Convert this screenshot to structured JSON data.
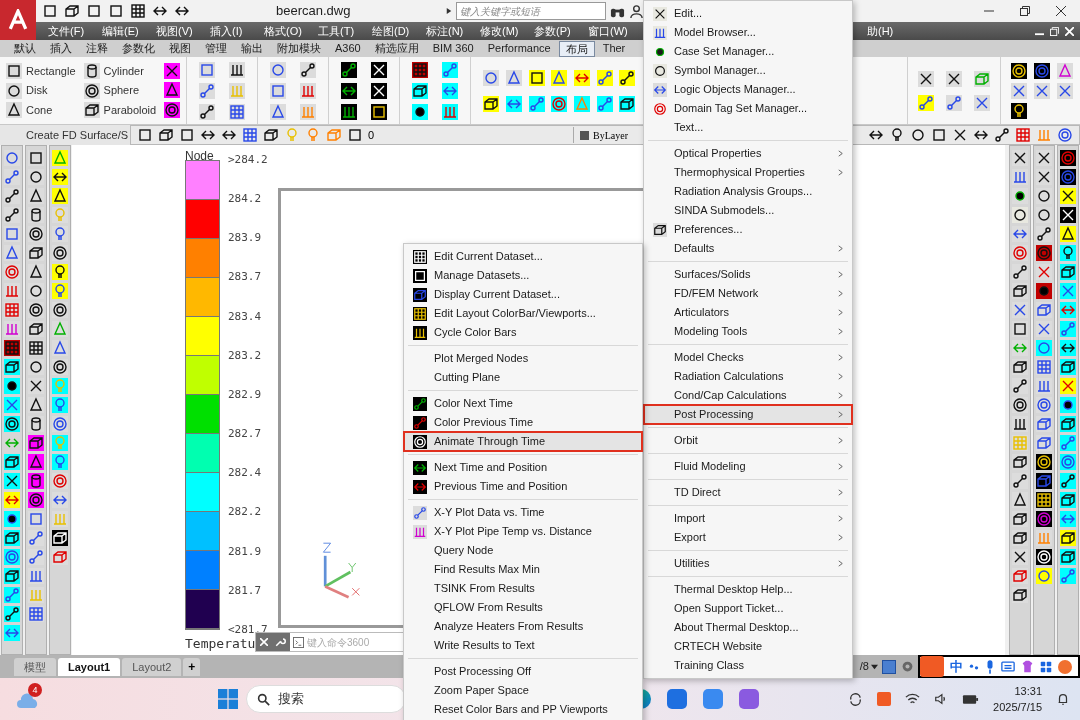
{
  "title_bar": {
    "title": "beercan.dwg",
    "search": {
      "placeholder": "键入关键字或短语"
    }
  },
  "menu_bar": {
    "items": [
      "文件(F)",
      "编辑(E)",
      "视图(V)",
      "插入(I)",
      "格式(O)",
      "工具(T)",
      "绘图(D)",
      "标注(N)",
      "修改(M)",
      "参数(P)",
      "窗口(W)"
    ],
    "help_fragment": "助(H)"
  },
  "ribbon_tabs": [
    {
      "label": "默认",
      "selected": false
    },
    {
      "label": "插入",
      "selected": false
    },
    {
      "label": "注释",
      "selected": false
    },
    {
      "label": "参数化",
      "selected": false
    },
    {
      "label": "视图",
      "selected": false
    },
    {
      "label": "管理",
      "selected": false
    },
    {
      "label": "输出",
      "selected": false
    },
    {
      "label": "附加模块",
      "selected": false
    },
    {
      "label": "A360",
      "selected": false
    },
    {
      "label": "精选应用",
      "selected": false
    },
    {
      "label": "BIM 360",
      "selected": false
    },
    {
      "label": "Performance",
      "selected": false
    },
    {
      "label": "布局",
      "selected": true
    },
    {
      "label": "Ther",
      "selected": false
    }
  ],
  "ribbon_panel": {
    "tools": [
      "Rectangle",
      "Cylinder",
      "Disk",
      "Sphere",
      "Cone",
      "Paraboloid"
    ],
    "panel_label": "Create FD Surface/S"
  },
  "toolbar": {
    "layer": "0",
    "linetype": "ByLayer"
  },
  "color_bar": {
    "title": "Node",
    "quantity": "Temperatu",
    "swatches": [
      {
        "color": "#ff80ff"
      },
      {
        "color": "#ff0000"
      },
      {
        "color": "#ff8000"
      },
      {
        "color": "#ffb800"
      },
      {
        "color": "#ffff00"
      },
      {
        "color": "#c0ff00"
      },
      {
        "color": "#00e000"
      },
      {
        "color": "#00ffb0"
      },
      {
        "color": "#00ffff"
      },
      {
        "color": "#00c0ff"
      },
      {
        "color": "#0080ff"
      },
      {
        "color": "#200050"
      }
    ],
    "labels": [
      ">284.2",
      "284.2",
      "283.9",
      "283.7",
      "283.4",
      "283.2",
      "282.9",
      "282.7",
      "282.4",
      "282.2",
      "281.9",
      "281.7",
      "<281.7"
    ]
  },
  "command_line": {
    "placeholder": "键入命令3600"
  },
  "layout_tabs": [
    {
      "label": "模型",
      "selected": false
    },
    {
      "label": "Layout1",
      "selected": true
    },
    {
      "label": "Layout2",
      "selected": false
    }
  ],
  "add_tab": "+",
  "status": {
    "text": "/8"
  },
  "ime_bar": {
    "mode": "中"
  },
  "taskbar": {
    "notification_count": "4",
    "search_placeholder": "搜索",
    "time": "13:31",
    "date": "2025/7/15"
  },
  "main_menu": {
    "items": [
      {
        "label": "Edit...",
        "kind": "icon",
        "submenu": false,
        "selected": false
      },
      {
        "label": "Model Browser...",
        "kind": "icon",
        "submenu": false,
        "selected": false
      },
      {
        "label": "Case Set Manager...",
        "kind": "icon",
        "submenu": false,
        "selected": false
      },
      {
        "label": "Symbol Manager...",
        "kind": "icon",
        "submenu": false,
        "selected": false
      },
      {
        "label": "Logic Objects Manager...",
        "kind": "icon",
        "submenu": false,
        "selected": false
      },
      {
        "label": "Domain Tag Set Manager...",
        "kind": "icon",
        "submenu": false,
        "selected": false
      },
      {
        "label": "Text...",
        "kind": "text",
        "submenu": false,
        "selected": false
      },
      {
        "kind": "separator"
      },
      {
        "label": "Optical Properties",
        "kind": "text",
        "submenu": true,
        "selected": false
      },
      {
        "label": "Thermophysical Properties",
        "kind": "text",
        "submenu": true,
        "selected": false
      },
      {
        "label": "Radiation Analysis Groups...",
        "kind": "text",
        "submenu": false,
        "selected": false
      },
      {
        "label": "SINDA Submodels...",
        "kind": "text",
        "submenu": false,
        "selected": false
      },
      {
        "label": "Preferences...",
        "kind": "icon",
        "submenu": false,
        "selected": false
      },
      {
        "label": "Defaults",
        "kind": "text",
        "submenu": true,
        "selected": false
      },
      {
        "kind": "separator"
      },
      {
        "label": "Surfaces/Solids",
        "kind": "text",
        "submenu": true,
        "selected": false
      },
      {
        "label": "FD/FEM Network",
        "kind": "text",
        "submenu": true,
        "selected": false
      },
      {
        "label": "Articulators",
        "kind": "text",
        "submenu": true,
        "selected": false
      },
      {
        "label": "Modeling Tools",
        "kind": "text",
        "submenu": true,
        "selected": false
      },
      {
        "kind": "separator"
      },
      {
        "label": "Model Checks",
        "kind": "text",
        "submenu": true,
        "selected": false
      },
      {
        "label": "Radiation Calculations",
        "kind": "text",
        "submenu": true,
        "selected": false
      },
      {
        "label": "Cond/Cap Calculations",
        "kind": "text",
        "submenu": true,
        "selected": false
      },
      {
        "label": "Post Processing",
        "kind": "text",
        "submenu": true,
        "selected": true
      },
      {
        "kind": "separator"
      },
      {
        "label": "Orbit",
        "kind": "text",
        "submenu": true,
        "selected": false
      },
      {
        "kind": "separator"
      },
      {
        "label": "Fluid Modeling",
        "kind": "text",
        "submenu": true,
        "selected": false
      },
      {
        "kind": "separator"
      },
      {
        "label": "TD Direct",
        "kind": "text",
        "submenu": true,
        "selected": false
      },
      {
        "kind": "separator"
      },
      {
        "label": "Import",
        "kind": "text",
        "submenu": true,
        "selected": false
      },
      {
        "label": "Export",
        "kind": "text",
        "submenu": true,
        "selected": false
      },
      {
        "kind": "separator"
      },
      {
        "label": "Utilities",
        "kind": "text",
        "submenu": true,
        "selected": false
      },
      {
        "kind": "separator"
      },
      {
        "label": "Thermal Desktop Help...",
        "kind": "text",
        "submenu": false,
        "selected": false
      },
      {
        "label": "Open Support Ticket...",
        "kind": "text",
        "submenu": false,
        "selected": false
      },
      {
        "label": "About Thermal Desktop...",
        "kind": "text",
        "submenu": false,
        "selected": false
      },
      {
        "label": "CRTECH Website",
        "kind": "text",
        "submenu": false,
        "selected": false
      },
      {
        "label": "Training Class",
        "kind": "text",
        "submenu": false,
        "selected": false
      }
    ]
  },
  "post_processing_menu": {
    "items": [
      {
        "label": "Edit Current Dataset...",
        "kind": "icon",
        "selected": false
      },
      {
        "label": "Manage Datasets...",
        "kind": "icon",
        "selected": false
      },
      {
        "label": "Display Current Dataset...",
        "kind": "icon",
        "selected": false
      },
      {
        "label": "Edit Layout ColorBar/Viewports...",
        "kind": "icon",
        "selected": false
      },
      {
        "label": "Cycle Color Bars",
        "kind": "icon",
        "selected": false
      },
      {
        "kind": "separator"
      },
      {
        "label": "Plot Merged Nodes",
        "kind": "text",
        "selected": false
      },
      {
        "label": "Cutting Plane",
        "kind": "text",
        "selected": false
      },
      {
        "kind": "separator"
      },
      {
        "label": "Color Next Time",
        "kind": "icon",
        "selected": false
      },
      {
        "label": "Color Previous Time",
        "kind": "icon",
        "selected": false
      },
      {
        "label": "Animate Through Time",
        "kind": "icon",
        "selected": true
      },
      {
        "kind": "separator"
      },
      {
        "label": "Next Time and Position",
        "kind": "icon",
        "selected": false
      },
      {
        "label": "Previous Time and Position",
        "kind": "icon",
        "selected": false
      },
      {
        "kind": "separator"
      },
      {
        "label": "X-Y Plot Data vs. Time",
        "kind": "icon",
        "selected": false
      },
      {
        "label": "X-Y Plot Pipe Temp vs. Distance",
        "kind": "icon",
        "selected": false
      },
      {
        "label": "Query Node",
        "kind": "text",
        "selected": false
      },
      {
        "label": "Find Results Max Min",
        "kind": "text",
        "selected": false
      },
      {
        "label": "TSINK From Results",
        "kind": "text",
        "selected": false
      },
      {
        "label": "QFLOW From Results",
        "kind": "text",
        "selected": false
      },
      {
        "label": "Analyze Heaters From Results",
        "kind": "text",
        "selected": false
      },
      {
        "label": "Write Results to Text",
        "kind": "text",
        "selected": false
      },
      {
        "kind": "separator"
      },
      {
        "label": "Post Processing Off",
        "kind": "text",
        "selected": false
      },
      {
        "label": "Zoom Paper Space",
        "kind": "text",
        "selected": false
      },
      {
        "label": "Reset Color Bars and PP Viewports",
        "kind": "text",
        "selected": false
      }
    ]
  }
}
